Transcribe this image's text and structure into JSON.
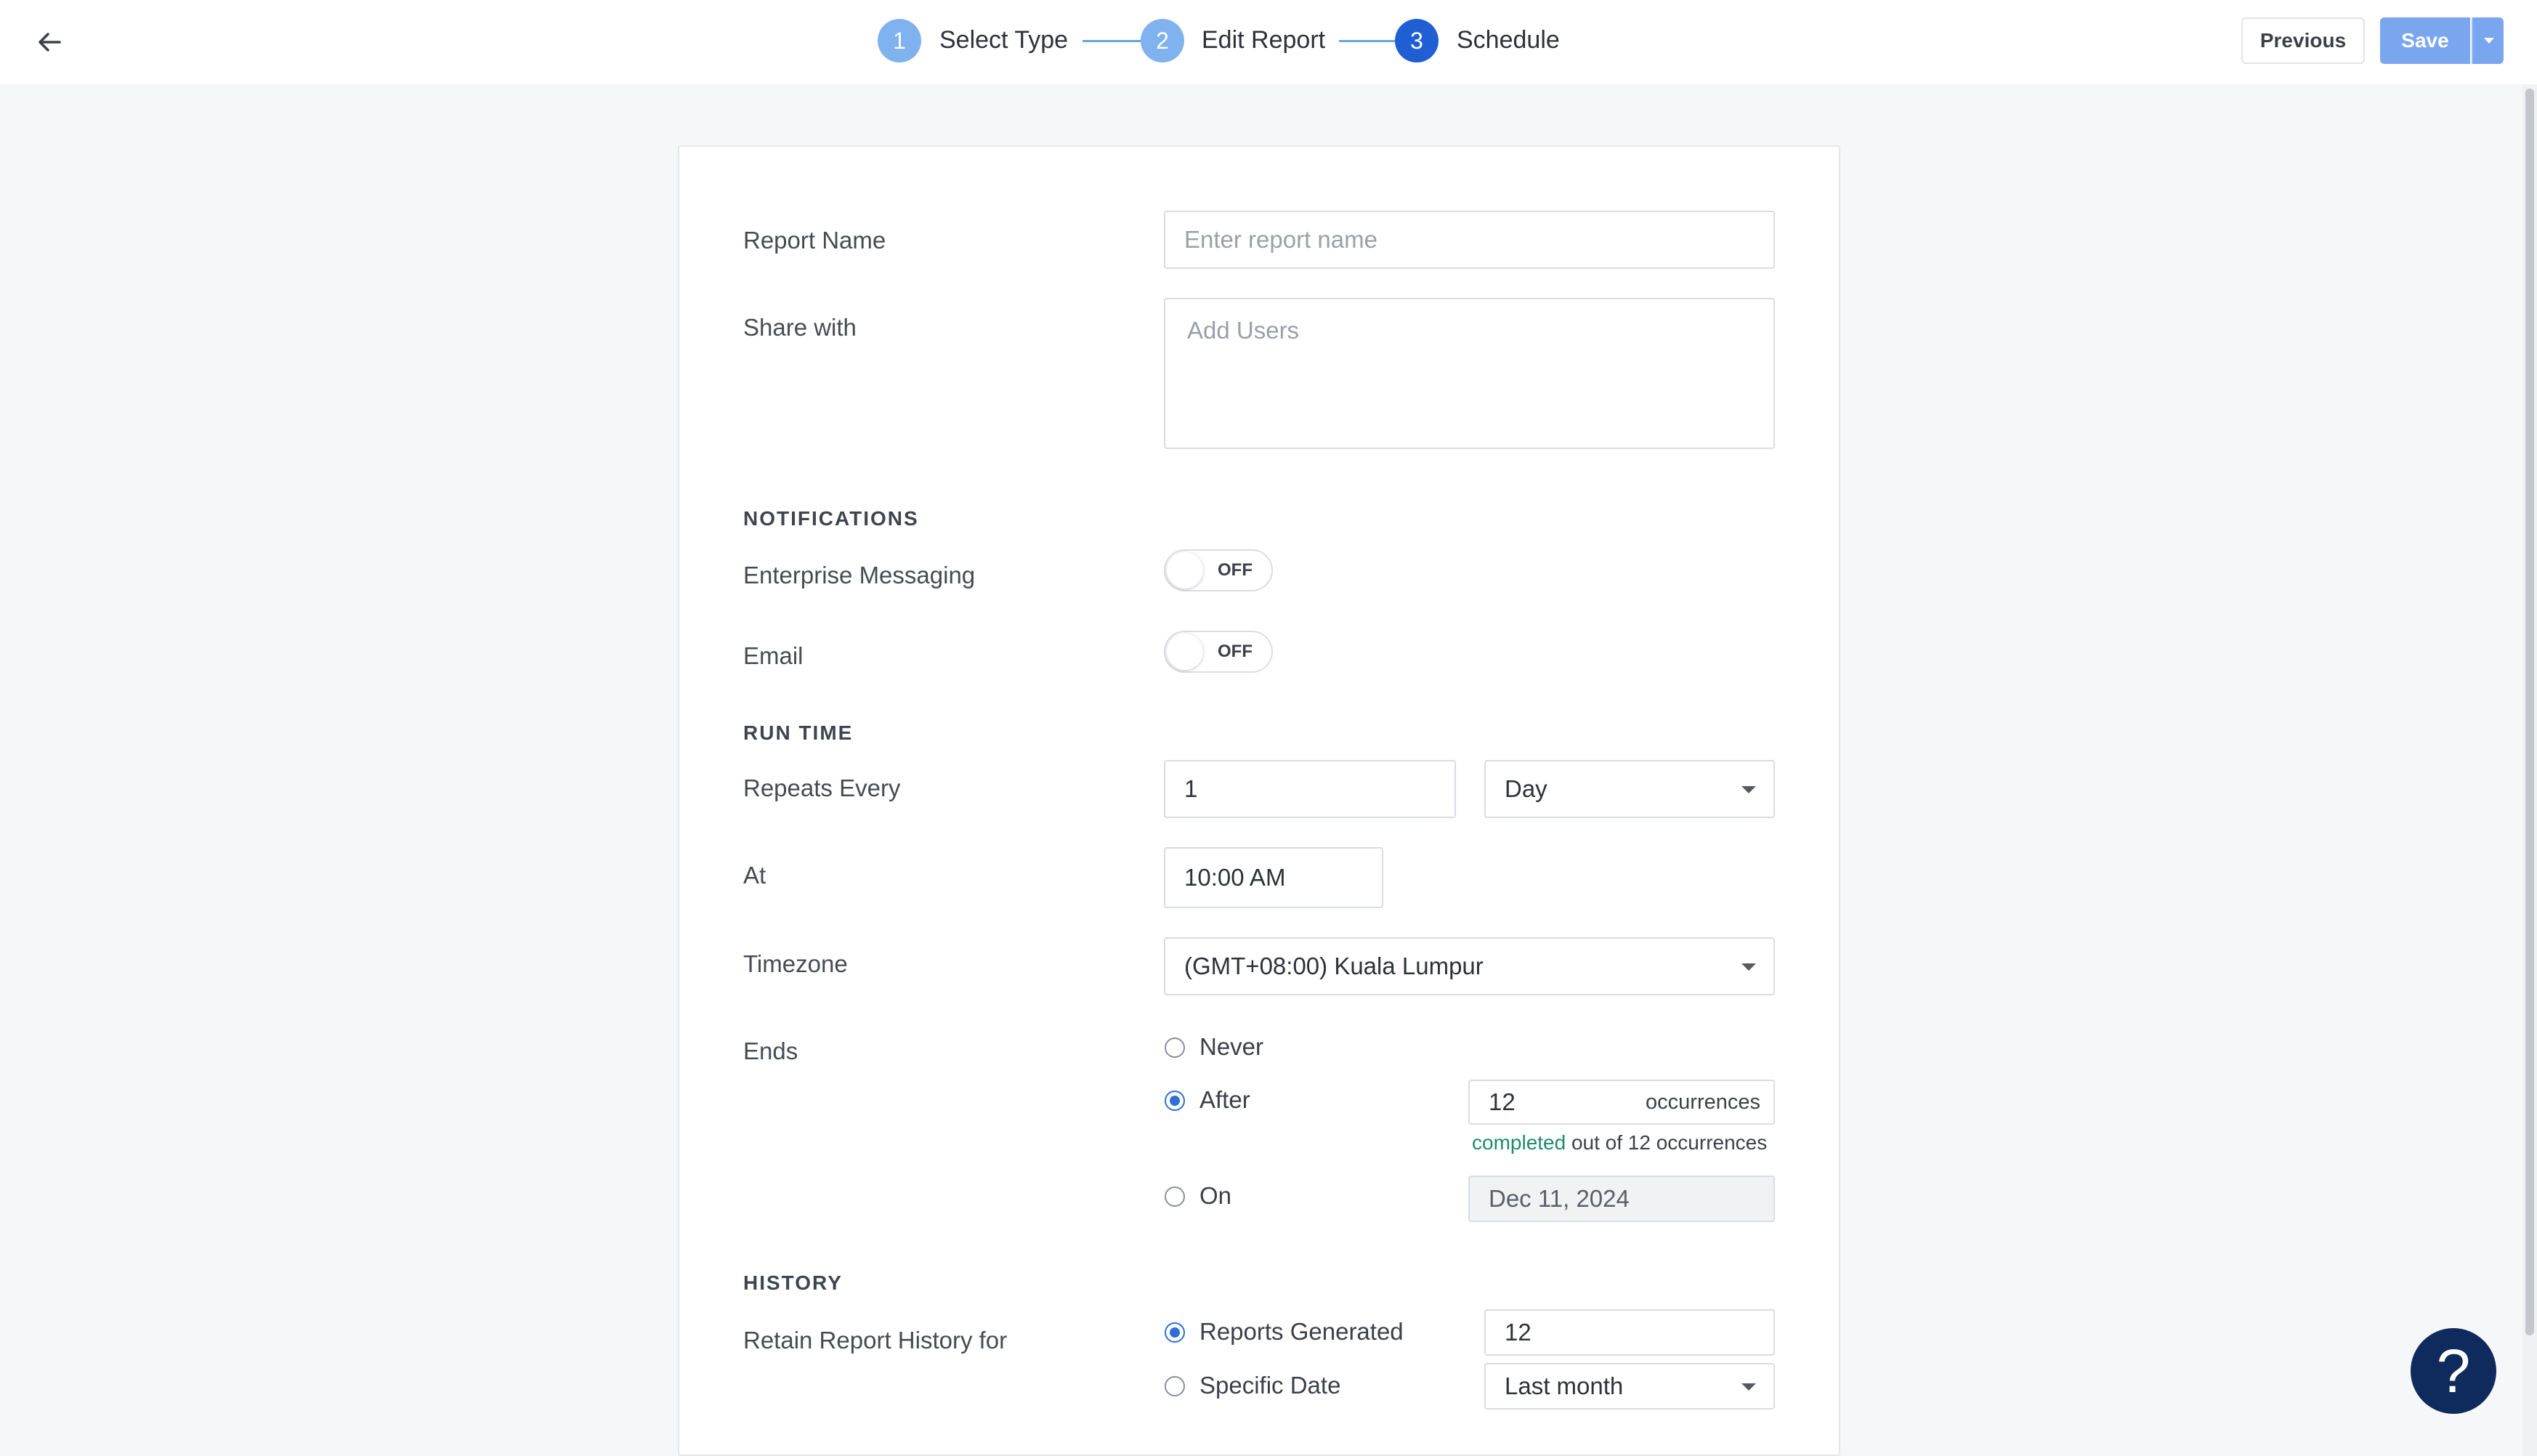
{
  "header": {
    "back_icon": "arrow-left-icon",
    "steps": [
      {
        "number": "1",
        "label": "Select Type",
        "color": "#7fb2ee"
      },
      {
        "number": "2",
        "label": "Edit Report",
        "color": "#7fb2ee"
      },
      {
        "number": "3",
        "label": "Schedule",
        "color": "#1f5fd3"
      }
    ],
    "previous_label": "Previous",
    "save_label": "Save",
    "save_color": "#7aa6f0"
  },
  "form": {
    "report_name": {
      "label": "Report Name",
      "placeholder": "Enter report name",
      "value": ""
    },
    "share_with": {
      "label": "Share with",
      "placeholder": "Add Users"
    },
    "notifications": {
      "heading": "NOTIFICATIONS",
      "enterprise_messaging": {
        "label": "Enterprise Messaging",
        "state": "OFF"
      },
      "email": {
        "label": "Email",
        "state": "OFF"
      }
    },
    "run_time": {
      "heading": "RUN TIME",
      "repeats_every": {
        "label": "Repeats Every",
        "value": "1",
        "unit": "Day"
      },
      "at": {
        "label": "At",
        "value": "10:00 AM"
      },
      "timezone": {
        "label": "Timezone",
        "value": "(GMT+08:00) Kuala Lumpur"
      },
      "ends": {
        "label": "Ends",
        "never_label": "Never",
        "after_label": "After",
        "after_value": "12",
        "after_suffix": "occurrences",
        "completed_word": "completed",
        "completed_rest": "out of 12 occurrences",
        "on_label": "On",
        "on_value": "Dec 11, 2024",
        "selected": "After"
      }
    },
    "history": {
      "heading": "HISTORY",
      "retain_label": "Retain Report History for",
      "reports_generated_label": "Reports Generated",
      "reports_generated_value": "12",
      "specific_date_label": "Specific Date",
      "specific_date_value": "Last month",
      "selected": "Reports Generated"
    }
  },
  "help": {
    "label": "?",
    "color": "#0f2a5c"
  }
}
